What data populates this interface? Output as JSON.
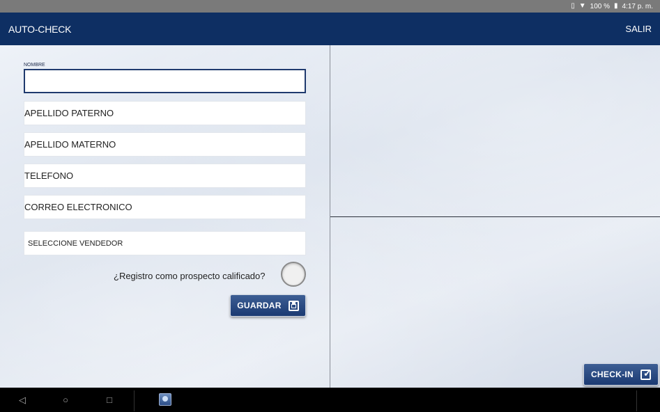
{
  "status_bar": {
    "battery_percent": "100 %",
    "time": "4:17 p. m.",
    "icons": [
      "vibrate-icon",
      "wifi-icon",
      "battery-icon"
    ]
  },
  "app_bar": {
    "title": "AUTO-CHECK",
    "exit_label": "SALIR"
  },
  "form": {
    "nombre": {
      "label": "NOMBRE",
      "value": ""
    },
    "apellido_paterno": {
      "placeholder": "APELLIDO PATERNO",
      "value": ""
    },
    "apellido_materno": {
      "placeholder": "APELLIDO MATERNO",
      "value": ""
    },
    "telefono": {
      "placeholder": "TELEFONO",
      "value": ""
    },
    "correo": {
      "placeholder": "CORREO ELECTRONICO",
      "value": ""
    },
    "vendedor": {
      "selected": "SELECCIONE VENDEDOR"
    },
    "prospect_question": "¿Registro como prospecto calificado?",
    "prospect_checked": false,
    "save_label": "GUARDAR"
  },
  "checkin_label": "CHECK-IN",
  "colors": {
    "primary": "#0e2f63",
    "button": "#1b3a72"
  }
}
